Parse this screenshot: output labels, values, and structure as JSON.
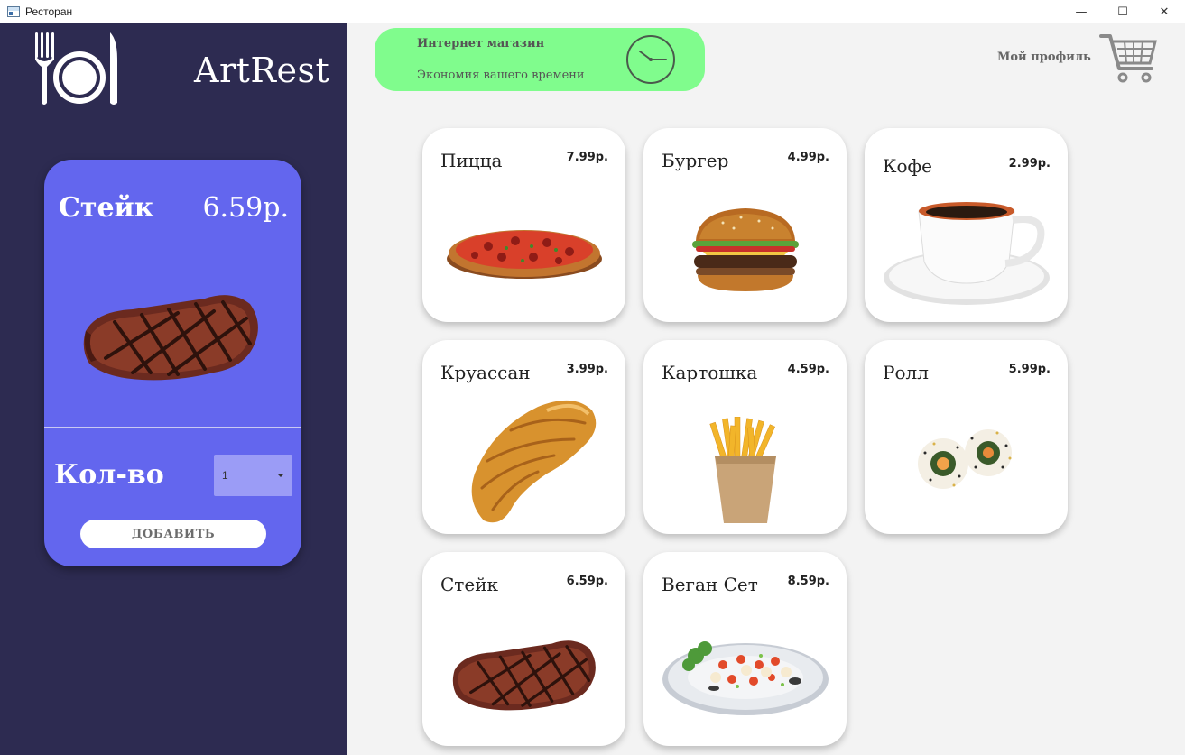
{
  "window": {
    "title": "Ресторан",
    "controls": {
      "minimize": "—",
      "maximize": "☐",
      "close": "✕"
    }
  },
  "sidebar": {
    "brand": "ArtRest",
    "logo_icon": "fork-plate-knife-icon",
    "detail": {
      "name": "Стейк",
      "price": "6.59р.",
      "image": "steak-image",
      "qty_label": "Кол-во",
      "qty_value": "1",
      "add_label": "ДОБАВИТЬ"
    }
  },
  "header": {
    "banner_title": "Интернет магазин",
    "banner_subtitle": "Экономия вашего времени",
    "banner_icon": "clock-icon",
    "profile_label": "Мой профиль",
    "cart_icon": "shopping-cart-icon"
  },
  "colors": {
    "sidebar_bg": "#2d2b51",
    "card_accent": "#6366ee",
    "banner_green": "#80fc8d",
    "page_bg": "#f3f3f3"
  },
  "products": [
    {
      "name": "Пицца",
      "price": "7.99р.",
      "image": "pizza-image"
    },
    {
      "name": "Бургер",
      "price": "4.99р.",
      "image": "burger-image"
    },
    {
      "name": "Кофе",
      "price": "2.99р.",
      "image": "coffee-image"
    },
    {
      "name": "Круассан",
      "price": "3.99р.",
      "image": "croissant-image"
    },
    {
      "name": "Картошка",
      "price": "4.59р.",
      "image": "fries-image"
    },
    {
      "name": "Ролл",
      "price": "5.99р.",
      "image": "roll-image"
    },
    {
      "name": "Стейк",
      "price": "6.59р.",
      "image": "steak-image"
    },
    {
      "name": "Веган Сет",
      "price": "8.59р.",
      "image": "vegan-set-image"
    }
  ]
}
